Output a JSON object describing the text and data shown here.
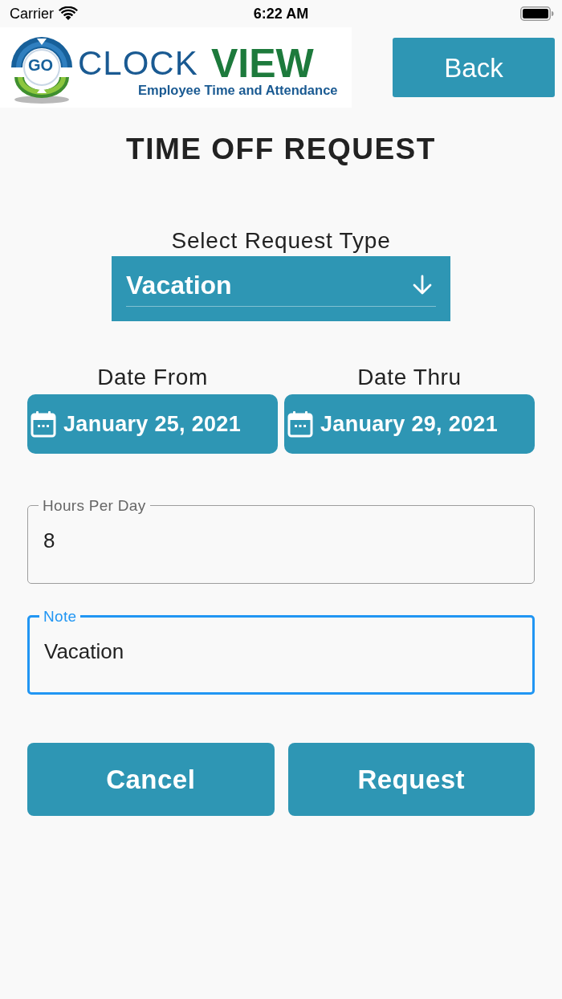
{
  "status_bar": {
    "carrier": "Carrier",
    "time": "6:22 AM"
  },
  "header": {
    "logo": {
      "badge": "GO",
      "name_part_1": "CLOCK",
      "name_part_2": "VIEW",
      "tagline": "Employee Time and Attendance"
    },
    "back_button": "Back"
  },
  "title": "TIME OFF REQUEST",
  "request_type": {
    "label": "Select Request Type",
    "value": "Vacation"
  },
  "dates": [
    {
      "label": "Date From",
      "value": "January 25, 2021"
    },
    {
      "label": "Date Thru",
      "value": "January 29, 2021"
    }
  ],
  "fields": [
    {
      "label": "Hours Per Day",
      "value": "8",
      "focused": false
    },
    {
      "label": "Note",
      "value": "Vacation",
      "focused": true
    }
  ],
  "buttons": [
    "Cancel",
    "Request"
  ]
}
